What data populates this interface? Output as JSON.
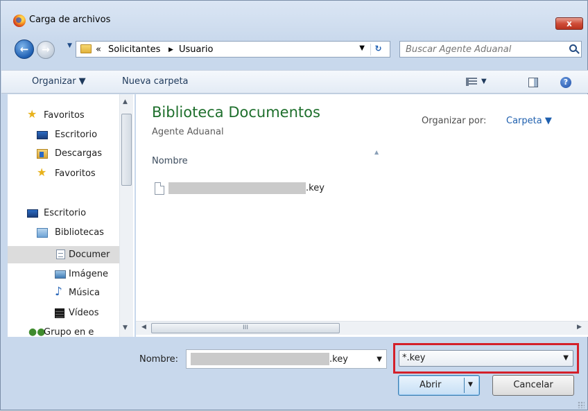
{
  "window": {
    "title": "Carga de archivos",
    "close_label": "x"
  },
  "address_bar": {
    "back_label": "←",
    "forward_label": "→",
    "overflow": "«",
    "crumbs": [
      "Solicitantes",
      "Usuario"
    ],
    "separator": "▶",
    "refresh_label": "↻",
    "search_placeholder": "Buscar Agente Aduanal"
  },
  "toolbar": {
    "organize_label": "Organizar ▼",
    "new_folder_label": "Nueva carpeta",
    "help_label": "?"
  },
  "nav_pane": {
    "items": [
      {
        "label": "Favoritos",
        "icon": "star-icon"
      },
      {
        "label": "Escritorio",
        "icon": "desktop-icon"
      },
      {
        "label": "Descargas",
        "icon": "downloads-icon"
      },
      {
        "label": "Favoritos",
        "icon": "star-icon"
      },
      {
        "label": "Escritorio",
        "icon": "desktop-icon"
      },
      {
        "label": "Bibliotecas",
        "icon": "libraries-icon"
      },
      {
        "label": "Documer",
        "icon": "documents-icon",
        "selected": true
      },
      {
        "label": "Imágene",
        "icon": "pictures-icon"
      },
      {
        "label": "Música",
        "icon": "music-icon"
      },
      {
        "label": "Vídeos",
        "icon": "videos-icon"
      },
      {
        "label": "Grupo en e",
        "icon": "homegroup-icon"
      }
    ]
  },
  "main": {
    "library_title": "Biblioteca Documentos",
    "library_subtitle": "Agente Aduanal",
    "arrange_label": "Organizar por:",
    "arrange_value": "Carpeta ▼",
    "column_name": "Nombre",
    "files": [
      {
        "name_suffix": ".key"
      }
    ],
    "hscroll_grip": "III"
  },
  "bottom": {
    "name_label": "Nombre:",
    "name_value_suffix": ".key",
    "filter_value": "*.key",
    "open_label": "Abrir",
    "cancel_label": "Cancelar"
  },
  "colors": {
    "library_title": "#1e6f2c",
    "highlight_border": "#d4202a",
    "link": "#1e5fae"
  }
}
